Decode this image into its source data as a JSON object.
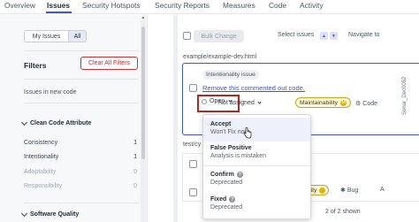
{
  "topnav": {
    "tabs": [
      {
        "label": "Overview"
      },
      {
        "label": "Issues",
        "active": true
      },
      {
        "label": "Security Hotspots"
      },
      {
        "label": "Security Reports"
      },
      {
        "label": "Measures"
      },
      {
        "label": "Code"
      },
      {
        "label": "Activity"
      }
    ]
  },
  "sidebar": {
    "my_issues_label": "My Issues",
    "all_label": "All",
    "filters_title": "Filters",
    "clear_all_label": "Clear All Filters",
    "new_code_label": "Issues in new code",
    "clean_code_section": "Clean Code Attribute",
    "facets": [
      {
        "label": "Consistency",
        "count": "1"
      },
      {
        "label": "Intentionality",
        "count": "1"
      },
      {
        "label": "Adaptability",
        "count": "0"
      },
      {
        "label": "Responsibility",
        "count": "0"
      }
    ],
    "software_quality_section": "Software Quality"
  },
  "main": {
    "bulk_change_label": "Bulk Change",
    "select_issues_label": "Select issues",
    "navigate_label": "Navigate to",
    "file1_path": "example/example-dev.html",
    "file2_path": "test/cy",
    "issue": {
      "tag": "Intentionality issue",
      "title": "Remove this commented out code.",
      "status": "Open",
      "assignee": "Not assigned",
      "quality": "Maintainability",
      "quality_severity_icon": "M",
      "code_label": "Code"
    },
    "issue2": {
      "quality": "ability",
      "type": "Bug",
      "extra": "A"
    },
    "count_text": "2 of 2 shown"
  },
  "dropdown": {
    "items": [
      {
        "title": "Accept",
        "subtitle": "Won't Fix now"
      },
      {
        "title": "False Positive",
        "subtitle": "Analysis is mistaken"
      },
      {
        "title": "Confirm",
        "subtitle": "Deprecated"
      },
      {
        "title": "Fixed",
        "subtitle": "Deprecated"
      }
    ]
  },
  "watermark": "Sonar_Dec0052",
  "colors": {
    "accent": "#3e56d1",
    "danger": "#d0312d",
    "maintainability": "#e0b400"
  }
}
